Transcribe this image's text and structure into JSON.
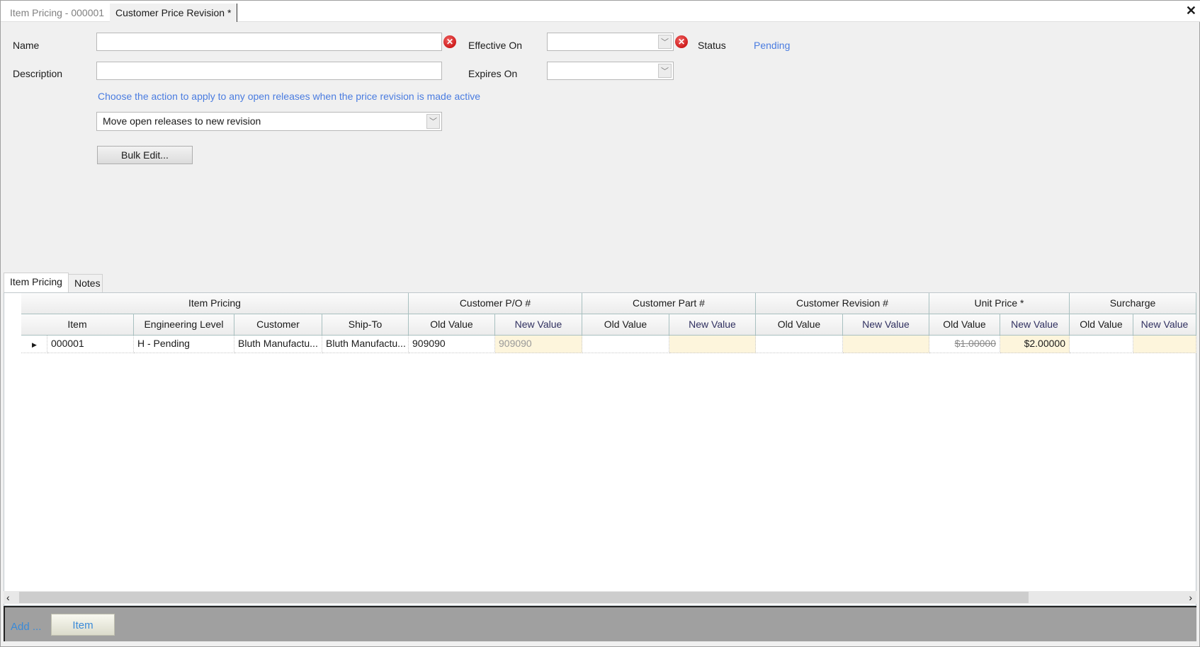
{
  "tabs": [
    {
      "label": "Item Pricing - 000001",
      "active": false
    },
    {
      "label": "Customer Price Revision *",
      "active": true
    }
  ],
  "form": {
    "name_label": "Name",
    "name_value": "",
    "description_label": "Description",
    "description_value": "",
    "effective_label": "Effective On",
    "effective_value": "",
    "expires_label": "Expires On",
    "expires_value": "",
    "status_label": "Status",
    "status_value": "Pending",
    "hint": "Choose the action to apply to any open releases when the price revision is made active",
    "release_action": "Move open releases to new revision",
    "bulk_edit": "Bulk Edit..."
  },
  "panel_tabs": [
    {
      "label": "Item Pricing",
      "active": true
    },
    {
      "label": "Notes",
      "active": false
    }
  ],
  "grid": {
    "groups": [
      "Item Pricing",
      "Customer P/O #",
      "Customer Part #",
      "Customer Revision #",
      "Unit Price *",
      "Surcharge"
    ],
    "columns": [
      "Item",
      "Engineering Level",
      "Customer",
      "Ship-To",
      "Old Value",
      "New Value",
      "Old Value",
      "New Value",
      "Old Value",
      "New Value",
      "Old Value",
      "New Value",
      "Old Value",
      "New Value"
    ],
    "rows": [
      [
        "000001",
        "H - Pending",
        "Bluth  Manufactu...",
        "Bluth  Manufactu...",
        "909090",
        "909090",
        "",
        "",
        "",
        "",
        "$1.00000",
        "$2.00000",
        "",
        ""
      ]
    ]
  },
  "footer": {
    "add_label": "Add ...",
    "item_button": "Item"
  },
  "colors": {
    "link": "#4a7ce0",
    "new_value_bg": "#fdf5dc",
    "footer_bg": "#a0a0a0"
  }
}
